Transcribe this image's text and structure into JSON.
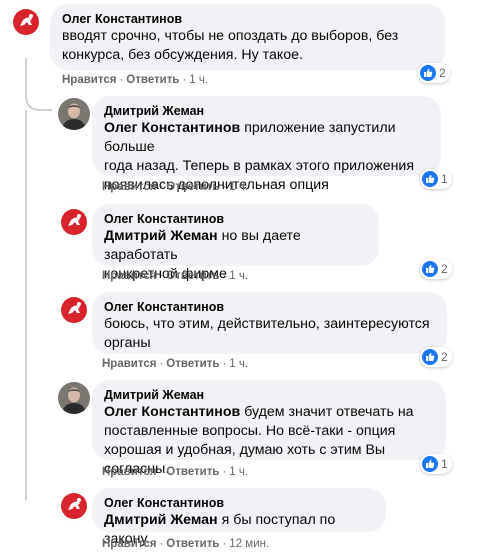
{
  "colors": {
    "bubble_bg": "#f0f2f5",
    "like_blue": "#1877f2",
    "meta_text": "#65676b",
    "avatar_red": "#d9232a"
  },
  "like_label": "Нравится",
  "reply_label": "Ответить",
  "separator": "·",
  "comments": [
    {
      "author": "Олег Константинов",
      "avatar": "pahonia-emblem-icon",
      "mention": "",
      "lines": [
        "вводят срочно, чтобы не опоздать до выборов, без",
        "конкурса, без обсуждения. Ну такое."
      ],
      "time": "1 ч.",
      "reactions": "2"
    },
    {
      "author": "Дмитрий Жеман",
      "avatar": "user-photo-icon",
      "mention": "Олег Константинов",
      "lines": [
        " приложение запустили больше",
        "года назад. Теперь в рамках этого приложения",
        "появилась дополнительная опция"
      ],
      "time": "1 ч.",
      "reactions": "1"
    },
    {
      "author": "Олег Константинов",
      "avatar": "pahonia-emblem-icon",
      "mention": "Дмитрий Жеман",
      "lines": [
        " но вы даете заработать",
        "конкретной фирме"
      ],
      "time": "1 ч.",
      "reactions": "2"
    },
    {
      "author": "Олег Константинов",
      "avatar": "pahonia-emblem-icon",
      "mention": "",
      "lines": [
        "боюсь, что этим, действительно, заинтересуются",
        "органы"
      ],
      "time": "1 ч.",
      "reactions": "2"
    },
    {
      "author": "Дмитрий Жеман",
      "avatar": "user-photo-icon",
      "mention": "Олег Константинов",
      "lines": [
        " будем значит отвечать на",
        "поставленные вопросы. Но всё-таки - опция",
        "хорошая и удобная, думаю хоть с этим Вы согласны."
      ],
      "time": "1 ч.",
      "reactions": "1"
    },
    {
      "author": "Олег Константинов",
      "avatar": "pahonia-emblem-icon",
      "mention": "Дмитрий Жеман",
      "lines": [
        " я бы поступал по закону."
      ],
      "time": "12 мин.",
      "reactions": ""
    }
  ]
}
